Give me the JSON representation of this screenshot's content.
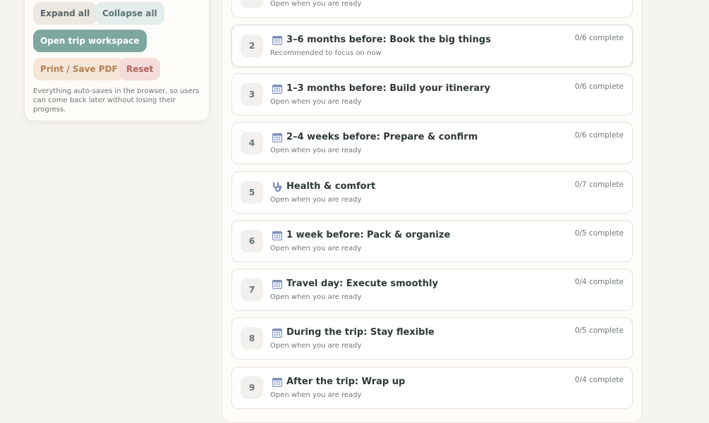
{
  "sidebar": {
    "expand_label": "Expand all",
    "collapse_label": "Collapse all",
    "open_label": "Open trip workspace",
    "print_label": "Print / Save PDF",
    "reset_label": "Reset",
    "note": "Everything auto-saves in the browser, so users can come back later without losing their progress."
  },
  "partial_card": {
    "subtitle": "Open when you are ready"
  },
  "sections": [
    {
      "number": "2",
      "icon": "calendar-icon",
      "title": "3–6 months before: Book the big things",
      "subtitle": "Recommended to focus on now",
      "progress": "0/6 complete"
    },
    {
      "number": "3",
      "icon": "calendar-icon",
      "title": "1–3 months before: Build your itinerary",
      "subtitle": "Open when you are ready",
      "progress": "0/6 complete"
    },
    {
      "number": "4",
      "icon": "calendar-icon",
      "title": "2–4 weeks before: Prepare & confirm",
      "subtitle": "Open when you are ready",
      "progress": "0/6 complete"
    },
    {
      "number": "5",
      "icon": "stethoscope-icon",
      "title": "Health & comfort",
      "subtitle": "Open when you are ready",
      "progress": "0/7 complete"
    },
    {
      "number": "6",
      "icon": "calendar-icon",
      "title": "1 week before: Pack & organize",
      "subtitle": "Open when you are ready",
      "progress": "0/5 complete"
    },
    {
      "number": "7",
      "icon": "calendar-icon",
      "title": "Travel day: Execute smoothly",
      "subtitle": "Open when you are ready",
      "progress": "0/4 complete"
    },
    {
      "number": "8",
      "icon": "calendar-icon",
      "title": "During the trip: Stay flexible",
      "subtitle": "Open when you are ready",
      "progress": "0/5 complete"
    },
    {
      "number": "9",
      "icon": "calendar-icon",
      "title": "After the trip: Wrap up",
      "subtitle": "Open when you are ready",
      "progress": "0/4 complete"
    }
  ]
}
